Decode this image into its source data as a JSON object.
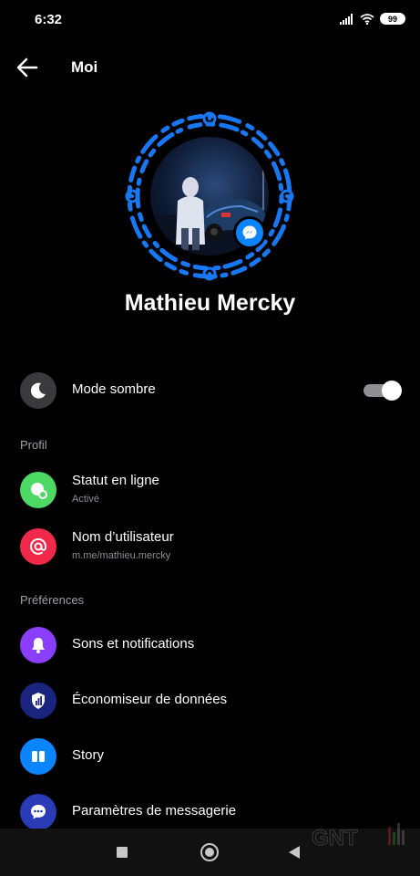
{
  "status_bar": {
    "time": "6:32",
    "battery": "99"
  },
  "header": {
    "title": "Moi"
  },
  "profile": {
    "name": "Mathieu Mercky"
  },
  "dark_mode": {
    "label": "Mode sombre",
    "enabled": true
  },
  "sections": [
    {
      "title": "Profil",
      "items": [
        {
          "label": "Statut en ligne",
          "sub": "Activé",
          "icon": "online-status-icon",
          "color": "#4cd964"
        },
        {
          "label": "Nom d’utilisateur",
          "sub": "m.me/mathieu.mercky",
          "icon": "at-sign-icon",
          "color": "#f02849"
        }
      ]
    },
    {
      "title": "Préférences",
      "items": [
        {
          "label": "Sons et notifications",
          "icon": "bell-icon",
          "color": "#8a3ffc"
        },
        {
          "label": "Économiseur de données",
          "icon": "shield-icon",
          "color": "#1a237e"
        },
        {
          "label": "Story",
          "icon": "story-icon",
          "color": "#0a84ff"
        },
        {
          "label": "Paramètres de messagerie",
          "icon": "chat-bubble-icon",
          "color": "#2a3bb5"
        }
      ]
    }
  ],
  "colors": {
    "accent": "#0a84ff",
    "background": "#000000"
  }
}
